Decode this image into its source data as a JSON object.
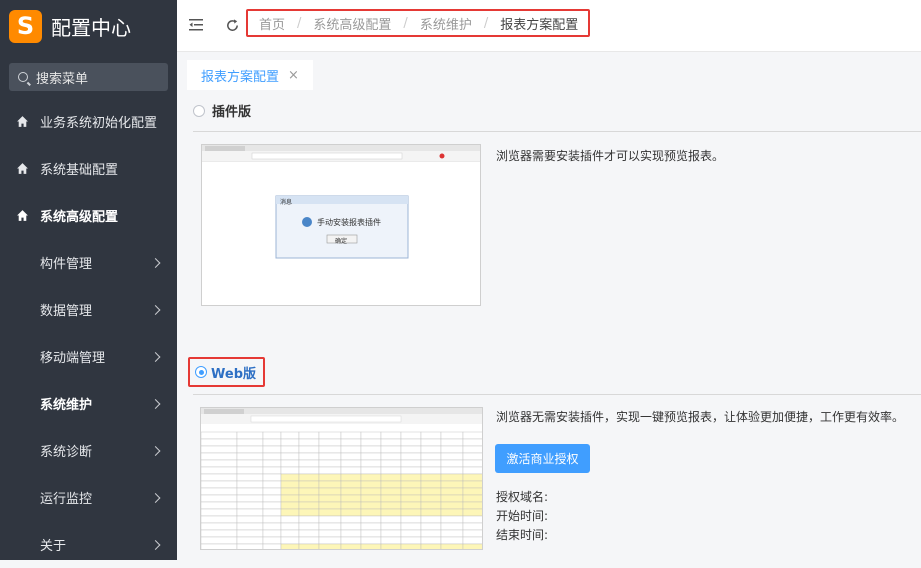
{
  "app": {
    "logo_letter": "S",
    "title": "配置中心"
  },
  "search": {
    "placeholder": "搜索菜单"
  },
  "sidebar": {
    "items": [
      {
        "label": "业务系统初始化配置",
        "icon": "home-icon"
      },
      {
        "label": "系统基础配置",
        "icon": "home-icon"
      },
      {
        "label": "系统高级配置",
        "icon": "home-icon"
      },
      {
        "label": "构件管理"
      },
      {
        "label": "数据管理"
      },
      {
        "label": "移动端管理"
      },
      {
        "label": "系统维护"
      },
      {
        "label": "系统诊断"
      },
      {
        "label": "运行监控"
      },
      {
        "label": "关于"
      }
    ]
  },
  "breadcrumb": [
    "首页",
    "系统高级配置",
    "系统维护",
    "报表方案配置"
  ],
  "breadcrumb_separator": "/",
  "tab": {
    "label": "报表方案配置",
    "close": "×"
  },
  "options": {
    "plugin": {
      "label": "插件版",
      "selected": false,
      "description": "浏览器需要安装插件才可以实现预览报表。",
      "preview": {
        "dialog_title": "消息",
        "dialog_message": "手动安装报表插件",
        "dialog_button": "确定"
      }
    },
    "web": {
      "label": "Web版",
      "selected": true,
      "description": "浏览器无需安装插件，实现一键预览报表，让体验更加便捷，工作更有效率。",
      "activate_label": "激活商业授权",
      "domain_label": "授权域名:",
      "start_label": "开始时间:",
      "end_label": "结束时间:"
    }
  },
  "colors": {
    "sidebar_bg": "#303640",
    "accent": "#409eff",
    "highlight": "#e53935",
    "logo": "#ff8a00"
  }
}
